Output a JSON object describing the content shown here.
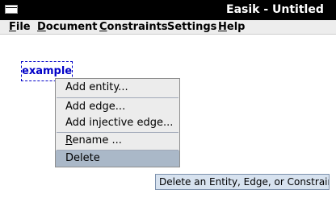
{
  "window": {
    "title": "Easik - Untitled"
  },
  "menubar": {
    "items": [
      {
        "mnemonic": "F",
        "rest": "ile"
      },
      {
        "mnemonic": "D",
        "rest": "ocument"
      },
      {
        "mnemonic": "C",
        "rest": "onstraints"
      },
      {
        "mnemonic": "",
        "rest": "Settings"
      },
      {
        "mnemonic": "H",
        "rest": "elp"
      }
    ]
  },
  "canvas": {
    "entity_label": "example"
  },
  "context_menu": {
    "items": [
      {
        "pre": "Add entity...",
        "mnemonic": "",
        "post": ""
      },
      {
        "pre": "Add edge...",
        "mnemonic": "",
        "post": ""
      },
      {
        "pre": "Add injective edge...",
        "mnemonic": "",
        "post": ""
      },
      {
        "pre": "",
        "mnemonic": "R",
        "post": "ename ..."
      },
      {
        "pre": "Delete",
        "mnemonic": "",
        "post": ""
      }
    ],
    "selected_index": 4
  },
  "tooltip": {
    "text": "Delete an Entity, Edge, or Constraint"
  }
}
